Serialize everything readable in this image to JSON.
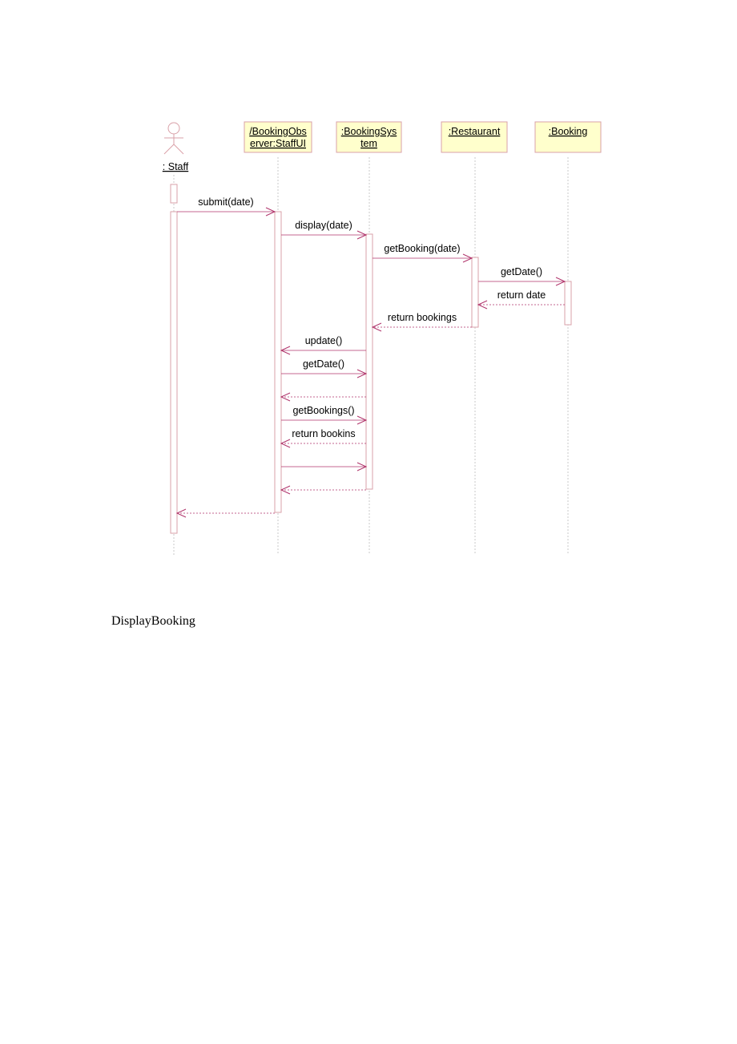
{
  "diagram": {
    "type": "uml-sequence",
    "colors": {
      "object_fill": "#ffffcc",
      "object_border": "#d9a0a8",
      "line": "#b0346b",
      "lifeline": "#c8c8c8",
      "actor": "#d9a0a8"
    },
    "actor": {
      "id": "staff",
      "label": ": Staff"
    },
    "objects": [
      {
        "id": "staffui",
        "lines": [
          "/BookingObs",
          "erver:StaffUI"
        ]
      },
      {
        "id": "bookingsystem",
        "lines": [
          ":BookingSys",
          "tem"
        ]
      },
      {
        "id": "restaurant",
        "lines": [
          ":Restaurant"
        ]
      },
      {
        "id": "booking",
        "lines": [
          ":Booking"
        ]
      }
    ],
    "messages": [
      {
        "from": "staff",
        "to": "staffui",
        "label": "submit(date)",
        "kind": "call"
      },
      {
        "from": "staffui",
        "to": "bookingsystem",
        "label": "display(date)",
        "kind": "call"
      },
      {
        "from": "bookingsystem",
        "to": "restaurant",
        "label": "getBooking(date)",
        "kind": "call"
      },
      {
        "from": "restaurant",
        "to": "booking",
        "label": "getDate()",
        "kind": "call"
      },
      {
        "from": "booking",
        "to": "restaurant",
        "label": "return date",
        "kind": "return"
      },
      {
        "from": "restaurant",
        "to": "bookingsystem",
        "label": "return bookings",
        "kind": "return"
      },
      {
        "from": "bookingsystem",
        "to": "staffui",
        "label": "update()",
        "kind": "call"
      },
      {
        "from": "staffui",
        "to": "bookingsystem",
        "label": "getDate()",
        "kind": "call"
      },
      {
        "from": "bookingsystem",
        "to": "staffui",
        "label": "",
        "kind": "return"
      },
      {
        "from": "staffui",
        "to": "bookingsystem",
        "label": "getBookings()",
        "kind": "call"
      },
      {
        "from": "bookingsystem",
        "to": "staffui",
        "label": "return bookins",
        "kind": "return"
      },
      {
        "from": "staffui",
        "to": "bookingsystem",
        "label": "",
        "kind": "call"
      },
      {
        "from": "bookingsystem",
        "to": "staffui",
        "label": "",
        "kind": "return"
      },
      {
        "from": "staffui",
        "to": "staff",
        "label": "",
        "kind": "return"
      }
    ]
  },
  "caption": "DisplayBooking"
}
